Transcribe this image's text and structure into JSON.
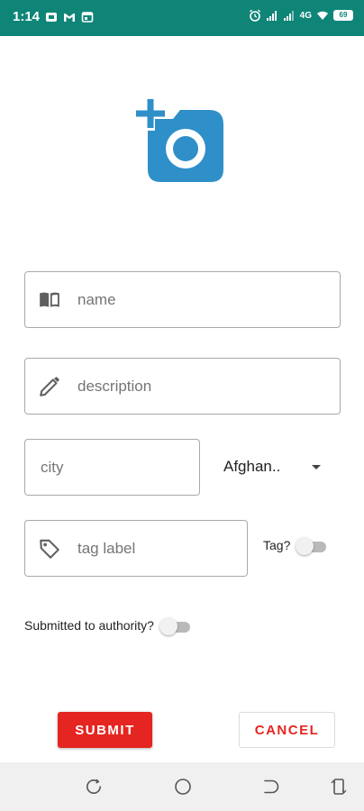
{
  "status_bar": {
    "time": "1:14",
    "battery": "69",
    "network": "4G"
  },
  "form": {
    "name_placeholder": "name",
    "description_placeholder": "description",
    "city_placeholder": "city",
    "country_value": "Afghan..",
    "tag_placeholder": "tag label",
    "tag_toggle_label": "Tag?",
    "tag_toggle_on": false,
    "authority_toggle_label": "Submitted to authority?",
    "authority_toggle_on": false
  },
  "actions": {
    "submit_label": "SUBMIT",
    "cancel_label": "CANCEL"
  },
  "colors": {
    "status_bar": "#0f8577",
    "camera_icon": "#2f8fc8",
    "primary_button": "#e52521",
    "nav_bar": "#f0f0f0"
  },
  "icons": {
    "camera": "add-a-photo-icon",
    "name": "book-icon",
    "description": "pencil-icon",
    "tag": "tag-icon",
    "dropdown": "caret-down-icon"
  }
}
